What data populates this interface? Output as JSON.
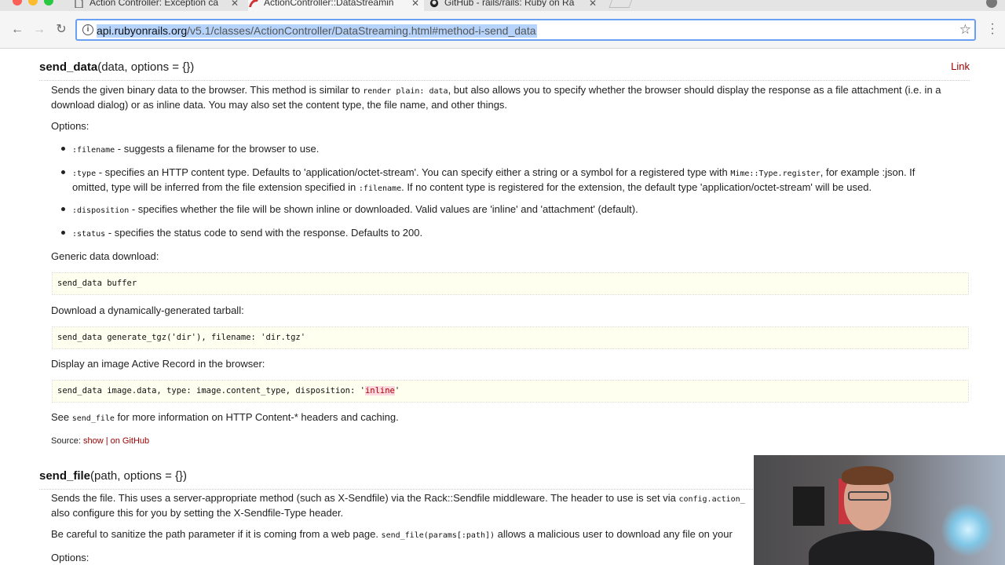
{
  "browser": {
    "tabs": [
      {
        "title": "Action Controller: Exception ca",
        "active": false
      },
      {
        "title": "ActionController::DataStreamin",
        "active": true
      },
      {
        "title": "GitHub - rails/rails: Ruby on Ra",
        "active": false
      }
    ],
    "url_host": "api.rubyonrails.org",
    "url_path": "/v5.1/classes/ActionController/DataStreaming.html#method-i-send_data"
  },
  "send_data": {
    "name": "send_data",
    "signature": "(data, options = {})",
    "link_label": "Link",
    "desc_1": "Sends the given binary data to the browser. This method is similar to ",
    "desc_code": "render plain: data",
    "desc_2": ", but also allows you to specify whether the browser should display the response as a file attachment (i.e. in a",
    "desc_3": "download dialog) or as inline data. You may also set the content type, the file name, and other things.",
    "options_label": "Options:",
    "options": [
      {
        "key": ":filename",
        "line1": " - suggests a filename for the browser to use.",
        "line2": ""
      },
      {
        "key": ":type",
        "line1": " - specifies an HTTP content type. Defaults to 'application/octet-stream'. You can specify either a string or a symbol for a registered type with ",
        "code1": "Mime::Type.register",
        "line1b": ", for example :json. If",
        "line2a": "omitted, type will be inferred from the file extension specified in ",
        "code2": ":filename",
        "line2b": ". If no content type is registered for the extension, the default type 'application/octet-stream' will be used."
      },
      {
        "key": ":disposition",
        "line1": " - specifies whether the file will be shown inline or downloaded. Valid values are 'inline' and 'attachment' (default).",
        "line2": ""
      },
      {
        "key": ":status",
        "line1": " - specifies the status code to send with the response. Defaults to 200.",
        "line2": ""
      }
    ],
    "generic_label": "Generic data download:",
    "code_1": "send_data buffer",
    "tarball_label": "Download a dynamically-generated tarball:",
    "code_2": "send_data generate_tgz('dir'), filename: 'dir.tgz'",
    "image_label": "Display an image Active Record in the browser:",
    "code_3a": "send_data image.data, type: image.content_type, disposition: '",
    "code_3hl": "inline",
    "code_3b": "'",
    "see_1": "See ",
    "see_code": "send_file",
    "see_2": " for more information on HTTP Content-* headers and caching.",
    "source_label": "Source: ",
    "source_show": "show",
    "source_sep": " | ",
    "source_github": "on GitHub"
  },
  "send_file": {
    "name": "send_file",
    "signature": "(path, options = {})",
    "desc_1": "Sends the file. This uses a server-appropriate method (such as X-Sendfile) via the Rack::Sendfile middleware. The header to use is set via ",
    "desc_code": "config.action_",
    "desc_2": "also configure this for you by setting the X-Sendfile-Type header.",
    "careful_1": "Be careful to sanitize the path parameter if it is coming from a web page. ",
    "careful_code": "send_file(params[:path])",
    "careful_2": " allows a malicious user to download any file on your",
    "options_label": "Options:"
  },
  "colors": {
    "link": "#990000",
    "code_bg": "#fffff0",
    "url_selection": "#b5d3fb"
  }
}
